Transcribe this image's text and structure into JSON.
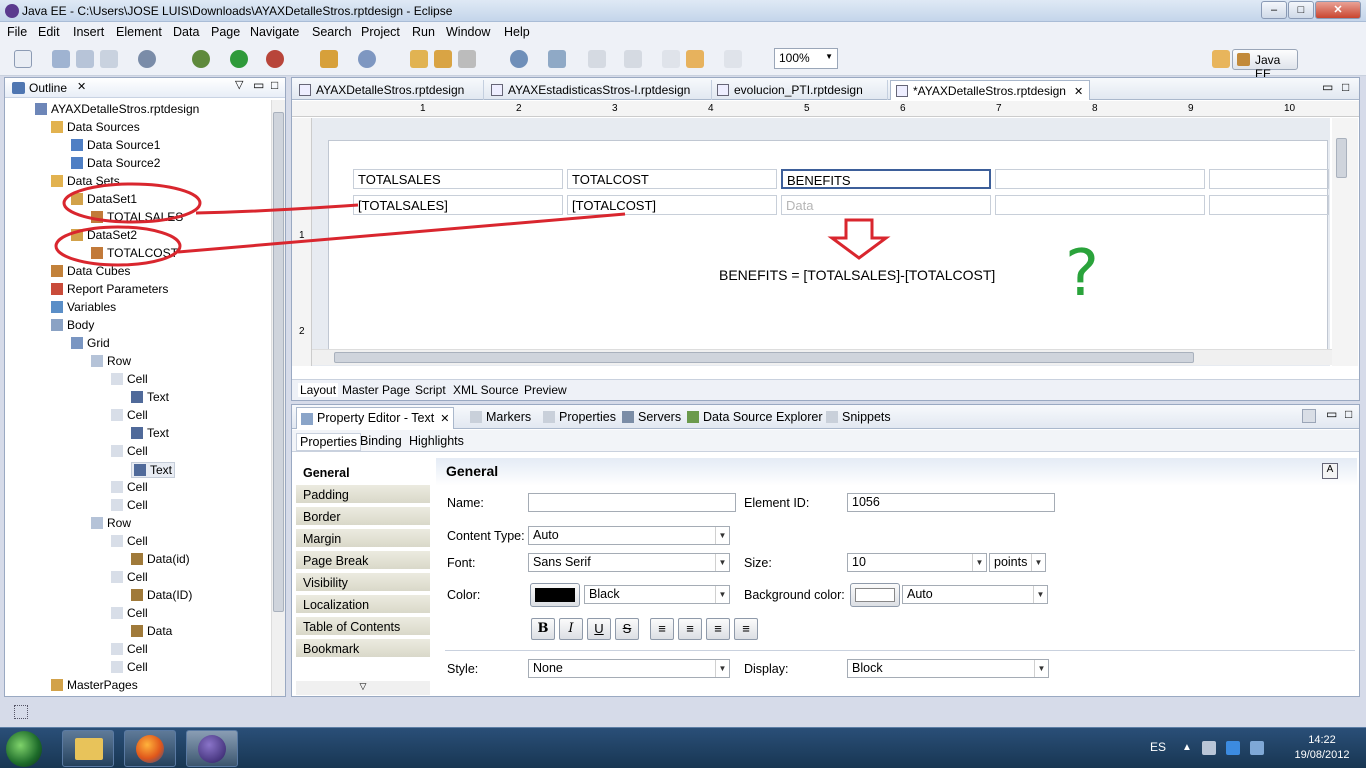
{
  "window": {
    "title": "Java EE - C:\\Users\\JOSE LUIS\\Downloads\\AYAXDetalleStros.rptdesign - Eclipse",
    "min": "–",
    "max": "□",
    "close": "✕"
  },
  "menu": [
    "File",
    "Edit",
    "Insert",
    "Element",
    "Data",
    "Page",
    "Navigate",
    "Search",
    "Project",
    "Run",
    "Window",
    "Help"
  ],
  "toolbar": {
    "zoom": "100%",
    "perspective": "Java EE"
  },
  "outline": {
    "title": "Outline",
    "items": [
      {
        "label": "AYAXDetalleStros.rptdesign",
        "icon": "report-icon"
      },
      {
        "label": "Data Sources",
        "icon": "folder-icon"
      },
      {
        "label": "Data Source1",
        "icon": "datasource-icon"
      },
      {
        "label": "Data Source2",
        "icon": "datasource-icon"
      },
      {
        "label": "Data Sets",
        "icon": "folder-icon"
      },
      {
        "label": "DataSet1",
        "icon": "dataset-icon"
      },
      {
        "label": "TOTALSALES",
        "icon": "column-icon"
      },
      {
        "label": "DataSet2",
        "icon": "dataset-icon"
      },
      {
        "label": "TOTALCOST",
        "icon": "column-icon"
      },
      {
        "label": "Data Cubes",
        "icon": "cube-icon"
      },
      {
        "label": "Report Parameters",
        "icon": "parameter-icon"
      },
      {
        "label": "Variables",
        "icon": "variable-icon"
      },
      {
        "label": "Body",
        "icon": "body-icon"
      },
      {
        "label": "Grid",
        "icon": "grid-icon"
      },
      {
        "label": "Row",
        "icon": "row-icon"
      },
      {
        "label": "Cell",
        "icon": "cell-icon"
      },
      {
        "label": "Text",
        "icon": "text-icon"
      },
      {
        "label": "Cell",
        "icon": "cell-icon"
      },
      {
        "label": "Text",
        "icon": "text-icon"
      },
      {
        "label": "Cell",
        "icon": "cell-icon"
      },
      {
        "label": "Text",
        "icon": "text-icon"
      },
      {
        "label": "Cell",
        "icon": "cell-icon"
      },
      {
        "label": "Cell",
        "icon": "cell-icon"
      },
      {
        "label": "Row",
        "icon": "row-icon"
      },
      {
        "label": "Cell",
        "icon": "cell-icon"
      },
      {
        "label": "Data(id)",
        "icon": "data-icon"
      },
      {
        "label": "Cell",
        "icon": "cell-icon"
      },
      {
        "label": "Data(ID)",
        "icon": "data-icon"
      },
      {
        "label": "Cell",
        "icon": "cell-icon"
      },
      {
        "label": "Data",
        "icon": "data-icon"
      },
      {
        "label": "Cell",
        "icon": "cell-icon"
      },
      {
        "label": "Cell",
        "icon": "cell-icon"
      },
      {
        "label": "MasterPages",
        "icon": "masterpage-icon"
      }
    ]
  },
  "editor": {
    "tabs": [
      "AYAXDetalleStros.rptdesign",
      "AYAXEstadisticasStros-I.rptdesign",
      "evolucion_PTI.rptdesign",
      "*AYAXDetalleStros.rptdesign"
    ],
    "ruler": [
      "1",
      "2",
      "3",
      "4",
      "5",
      "6",
      "7",
      "8",
      "9",
      "10"
    ],
    "vruler": [
      "1",
      "2"
    ],
    "row1": [
      "TOTALSALES",
      "TOTALCOST",
      "BENEFITS"
    ],
    "row2": [
      "[TOTALSALES]",
      "[TOTALCOST]",
      "Data"
    ],
    "formula": "BENEFITS = [TOTALSALES]-[TOTALCOST]",
    "question": "?",
    "bottom_tabs": [
      "Layout",
      "Master Page",
      "Script",
      "XML Source",
      "Preview"
    ]
  },
  "props": {
    "tabs": [
      "Property Editor - Text",
      "Markers",
      "Properties",
      "Servers",
      "Data Source Explorer",
      "Snippets"
    ],
    "subtabs": [
      "Properties",
      "Binding",
      "Highlights"
    ],
    "categories": [
      "General",
      "Padding",
      "Border",
      "Margin",
      "Page Break",
      "Visibility",
      "Localization",
      "Table of Contents",
      "Bookmark"
    ],
    "section": "General",
    "name_label": "Name:",
    "name_value": "",
    "element_id_label": "Element ID:",
    "element_id": "1056",
    "content_type_label": "Content Type:",
    "content_type": "Auto",
    "font_label": "Font:",
    "font": "Sans Serif",
    "size_label": "Size:",
    "size": "10",
    "size_unit": "points",
    "color_label": "Color:",
    "color": "Black",
    "bg_label": "Background color:",
    "bg": "Auto",
    "style_label": "Style:",
    "style": "None",
    "display_label": "Display:",
    "display": "Block",
    "format_buttons": [
      "B",
      "I",
      "U",
      "S"
    ]
  },
  "taskbar": {
    "lang": "ES",
    "time": "14:22",
    "date": "19/08/2012"
  },
  "colors": {
    "annotation": "#d9262e",
    "question": "#2aa33b"
  }
}
